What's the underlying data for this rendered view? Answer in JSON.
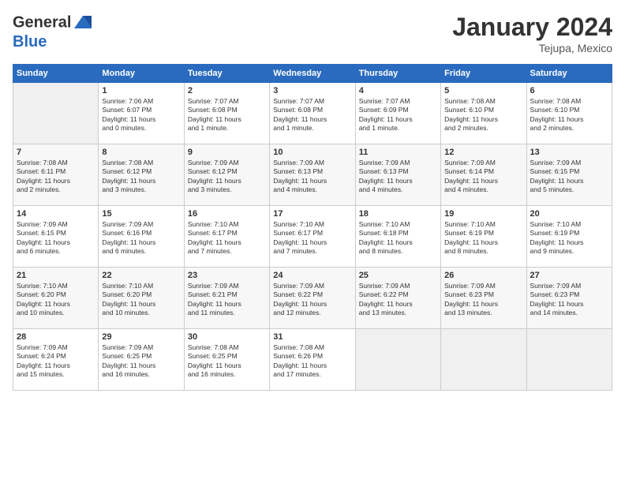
{
  "header": {
    "logo_line1": "General",
    "logo_line2": "Blue",
    "month": "January 2024",
    "location": "Tejupa, Mexico"
  },
  "days_of_week": [
    "Sunday",
    "Monday",
    "Tuesday",
    "Wednesday",
    "Thursday",
    "Friday",
    "Saturday"
  ],
  "weeks": [
    [
      {
        "day": "",
        "info": ""
      },
      {
        "day": "1",
        "info": "Sunrise: 7:06 AM\nSunset: 6:07 PM\nDaylight: 11 hours\nand 0 minutes."
      },
      {
        "day": "2",
        "info": "Sunrise: 7:07 AM\nSunset: 6:08 PM\nDaylight: 11 hours\nand 1 minute."
      },
      {
        "day": "3",
        "info": "Sunrise: 7:07 AM\nSunset: 6:08 PM\nDaylight: 11 hours\nand 1 minute."
      },
      {
        "day": "4",
        "info": "Sunrise: 7:07 AM\nSunset: 6:09 PM\nDaylight: 11 hours\nand 1 minute."
      },
      {
        "day": "5",
        "info": "Sunrise: 7:08 AM\nSunset: 6:10 PM\nDaylight: 11 hours\nand 2 minutes."
      },
      {
        "day": "6",
        "info": "Sunrise: 7:08 AM\nSunset: 6:10 PM\nDaylight: 11 hours\nand 2 minutes."
      }
    ],
    [
      {
        "day": "7",
        "info": "Sunrise: 7:08 AM\nSunset: 6:11 PM\nDaylight: 11 hours\nand 2 minutes."
      },
      {
        "day": "8",
        "info": "Sunrise: 7:08 AM\nSunset: 6:12 PM\nDaylight: 11 hours\nand 3 minutes."
      },
      {
        "day": "9",
        "info": "Sunrise: 7:09 AM\nSunset: 6:12 PM\nDaylight: 11 hours\nand 3 minutes."
      },
      {
        "day": "10",
        "info": "Sunrise: 7:09 AM\nSunset: 6:13 PM\nDaylight: 11 hours\nand 4 minutes."
      },
      {
        "day": "11",
        "info": "Sunrise: 7:09 AM\nSunset: 6:13 PM\nDaylight: 11 hours\nand 4 minutes."
      },
      {
        "day": "12",
        "info": "Sunrise: 7:09 AM\nSunset: 6:14 PM\nDaylight: 11 hours\nand 4 minutes."
      },
      {
        "day": "13",
        "info": "Sunrise: 7:09 AM\nSunset: 6:15 PM\nDaylight: 11 hours\nand 5 minutes."
      }
    ],
    [
      {
        "day": "14",
        "info": "Sunrise: 7:09 AM\nSunset: 6:15 PM\nDaylight: 11 hours\nand 6 minutes."
      },
      {
        "day": "15",
        "info": "Sunrise: 7:09 AM\nSunset: 6:16 PM\nDaylight: 11 hours\nand 6 minutes."
      },
      {
        "day": "16",
        "info": "Sunrise: 7:10 AM\nSunset: 6:17 PM\nDaylight: 11 hours\nand 7 minutes."
      },
      {
        "day": "17",
        "info": "Sunrise: 7:10 AM\nSunset: 6:17 PM\nDaylight: 11 hours\nand 7 minutes."
      },
      {
        "day": "18",
        "info": "Sunrise: 7:10 AM\nSunset: 6:18 PM\nDaylight: 11 hours\nand 8 minutes."
      },
      {
        "day": "19",
        "info": "Sunrise: 7:10 AM\nSunset: 6:19 PM\nDaylight: 11 hours\nand 8 minutes."
      },
      {
        "day": "20",
        "info": "Sunrise: 7:10 AM\nSunset: 6:19 PM\nDaylight: 11 hours\nand 9 minutes."
      }
    ],
    [
      {
        "day": "21",
        "info": "Sunrise: 7:10 AM\nSunset: 6:20 PM\nDaylight: 11 hours\nand 10 minutes."
      },
      {
        "day": "22",
        "info": "Sunrise: 7:10 AM\nSunset: 6:20 PM\nDaylight: 11 hours\nand 10 minutes."
      },
      {
        "day": "23",
        "info": "Sunrise: 7:09 AM\nSunset: 6:21 PM\nDaylight: 11 hours\nand 11 minutes."
      },
      {
        "day": "24",
        "info": "Sunrise: 7:09 AM\nSunset: 6:22 PM\nDaylight: 11 hours\nand 12 minutes."
      },
      {
        "day": "25",
        "info": "Sunrise: 7:09 AM\nSunset: 6:22 PM\nDaylight: 11 hours\nand 13 minutes."
      },
      {
        "day": "26",
        "info": "Sunrise: 7:09 AM\nSunset: 6:23 PM\nDaylight: 11 hours\nand 13 minutes."
      },
      {
        "day": "27",
        "info": "Sunrise: 7:09 AM\nSunset: 6:23 PM\nDaylight: 11 hours\nand 14 minutes."
      }
    ],
    [
      {
        "day": "28",
        "info": "Sunrise: 7:09 AM\nSunset: 6:24 PM\nDaylight: 11 hours\nand 15 minutes."
      },
      {
        "day": "29",
        "info": "Sunrise: 7:09 AM\nSunset: 6:25 PM\nDaylight: 11 hours\nand 16 minutes."
      },
      {
        "day": "30",
        "info": "Sunrise: 7:08 AM\nSunset: 6:25 PM\nDaylight: 11 hours\nand 16 minutes."
      },
      {
        "day": "31",
        "info": "Sunrise: 7:08 AM\nSunset: 6:26 PM\nDaylight: 11 hours\nand 17 minutes."
      },
      {
        "day": "",
        "info": ""
      },
      {
        "day": "",
        "info": ""
      },
      {
        "day": "",
        "info": ""
      }
    ]
  ]
}
